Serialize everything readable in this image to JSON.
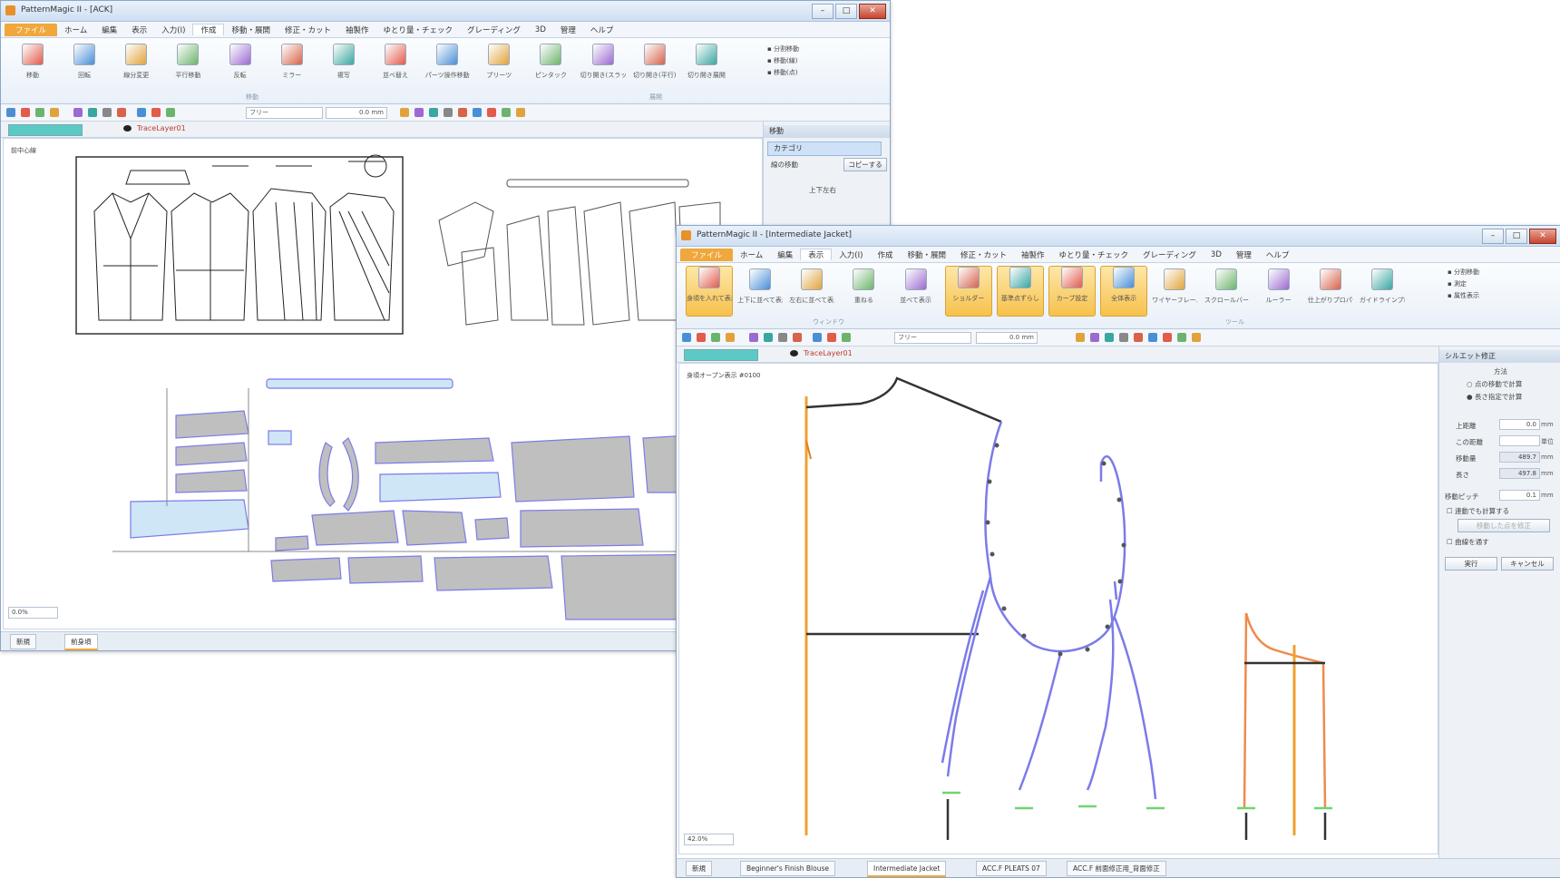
{
  "colors": {
    "accent": "#f0a73c",
    "pattern_blue": "#7b7bea",
    "pattern_orange": "#f08a4b",
    "grain_orange": "#f0a030",
    "piece_fill": "#bfbfbf",
    "piece_blue": "#cfe6f7",
    "layer_teal": "#5cc9c7",
    "layer_text": "#c0392b",
    "seam_green": "#6ed66e"
  },
  "w1": {
    "title": "PatternMagic II - [ACK]",
    "menu": [
      "ファイル",
      "ホーム",
      "編集",
      "表示",
      "入力(I)",
      "作成",
      "移動・展開",
      "修正・カット",
      "袖製作",
      "ゆとり量・チェック",
      "グレーディング",
      "3D",
      "管理",
      "ヘルプ"
    ],
    "active_menu_index": 5,
    "ribbon": [
      "移動",
      "回転",
      "線分変更",
      "平行移動",
      "反転",
      "ミラー",
      "複写",
      "並べ替え",
      "パーツ操作移動",
      "プリーツ",
      "ピンタック",
      "切り開き(スラッシュ)",
      "切り開き(平行)",
      "切り開き展開"
    ],
    "ribbon_small": [
      "分割移動",
      "移動(線)",
      "移動(点)"
    ],
    "group_labels": [
      "移動",
      "展開"
    ],
    "zoom": "フリー",
    "value": "0.0 mm",
    "layer_name": "TraceLayer01",
    "canvas_label": "前中心線",
    "panel": {
      "header": "移動",
      "selected": "カテゴリ",
      "row2": "線の移動",
      "row2_right": "コピーする",
      "section": "上下左右"
    },
    "zoom_combo": "0.0%",
    "tabs": [
      "新規",
      "前身頃"
    ]
  },
  "w2": {
    "title": "PatternMagic II - [Intermediate Jacket]",
    "menu": [
      "ファイル",
      "ホーム",
      "編集",
      "表示",
      "入力(I)",
      "作成",
      "移動・展開",
      "修正・カット",
      "袖製作",
      "ゆとり量・チェック",
      "グレーディング",
      "3D",
      "管理",
      "ヘルプ"
    ],
    "active_menu_index": 3,
    "ribbon": [
      "身頃を入れて表示",
      "上下に並べて表示",
      "左右に並べて表示",
      "重ねる",
      "並べて表示",
      "ショルダー",
      "基準点ずらし",
      "カーブ設定",
      "全体表示",
      "ワイヤーフレーム",
      "スクロールバー",
      "ルーラー",
      "仕上がりプロパティ",
      "ガイドラインプロパティ"
    ],
    "ribbon_small": [
      "分割移動",
      "測定",
      "属性表示"
    ],
    "group_labels": [
      "ウィンドウ",
      "ツール"
    ],
    "zoom": "フリー",
    "value": "0.0 mm",
    "layer_name": "TraceLayer01",
    "canvas_label": "身頃オープン表示 #0100",
    "panel": {
      "title": "シルエット修正",
      "option": "方法",
      "radio1": "点の移動で計算",
      "radio2": "長さ指定で計算",
      "f1_label": "上距離",
      "f1_val": "0.0",
      "f2_label": "この距離",
      "f3_label": "移動量",
      "f3_val": "489.7",
      "f4_label": "長さ",
      "f4_val": "497.8",
      "f5_label": "移動ピッチ",
      "f5_val": "0.1",
      "unit": "mm",
      "unit2": "単位",
      "chk1": "連動でも計算する",
      "chk1b": "移動した点を修正",
      "chk2": "曲線を通す",
      "ok": "実行",
      "cancel": "キャンセル"
    },
    "zoom_combo": "42.0%",
    "tabs": [
      "新規",
      "Beginner's Finish Blouse",
      "Intermediate Jacket",
      "ACC.F PLEATS 07",
      "ACC.F 前面修正用_背面修正"
    ]
  }
}
